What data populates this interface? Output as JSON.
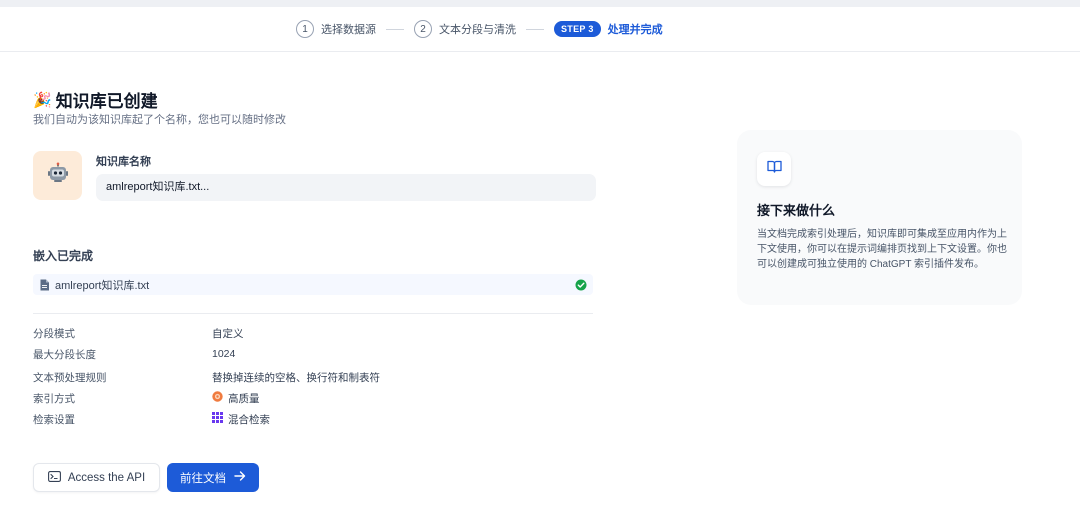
{
  "stepper": {
    "steps": [
      {
        "num": "1",
        "label": "选择数据源"
      },
      {
        "num": "2",
        "label": "文本分段与清洗"
      },
      {
        "badge": "STEP 3",
        "label": "处理并完成"
      }
    ]
  },
  "header": {
    "title": "知识库已创建",
    "subtitle": "我们自动为该知识库起了个名称，您也可以随时修改"
  },
  "kb": {
    "name_label": "知识库名称",
    "name_value": "amlreport知识库.txt..."
  },
  "embedding": {
    "title": "嵌入已完成",
    "file_name": "amlreport知识库.txt"
  },
  "info": [
    {
      "key": "分段模式",
      "value": "自定义",
      "icon": ""
    },
    {
      "key": "最大分段长度",
      "value": "1024",
      "icon": ""
    },
    {
      "key": "文本预处理规则",
      "value": "替换掉连续的空格、换行符和制表符",
      "icon": ""
    },
    {
      "key": "索引方式",
      "value": "高质量",
      "icon": "high-quality-icon"
    },
    {
      "key": "检索设置",
      "value": "混合检索",
      "icon": "grid-icon"
    }
  ],
  "actions": {
    "api_label": "Access the API",
    "docs_label": "前往文档"
  },
  "next": {
    "title": "接下来做什么",
    "description": "当文档完成索引处理后，知识库即可集成至应用内作为上下文使用，你可以在提示词编排页找到上下文设置。你也可以创建成可独立使用的 ChatGPT 索引插件发布。"
  },
  "colors": {
    "accent": "#1d5bd8",
    "success": "#16a34a",
    "avatar_bg": "#fdebd9"
  }
}
